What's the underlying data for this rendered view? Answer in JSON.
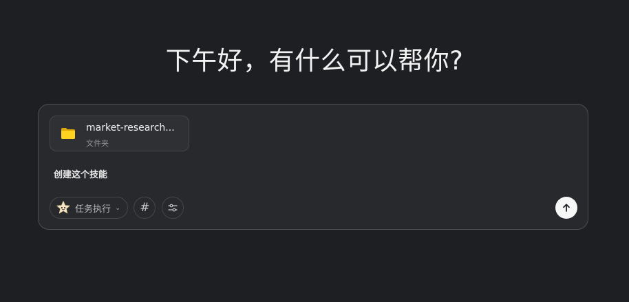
{
  "greeting": "下午好，有什么可以帮你?",
  "attachment": {
    "name": "market-research...",
    "type": "文件夹"
  },
  "message": "创建这个技能",
  "toolbar": {
    "mode_label": "任务执行",
    "mode_icon": "star-mascot-icon",
    "hash_label": "#",
    "settings_icon": "sliders-icon",
    "send_icon": "arrow-up-icon"
  },
  "colors": {
    "background": "#1e1f22",
    "composer": "#28292d",
    "folder": "#f7c500",
    "send_button": "#f7f7f7"
  }
}
